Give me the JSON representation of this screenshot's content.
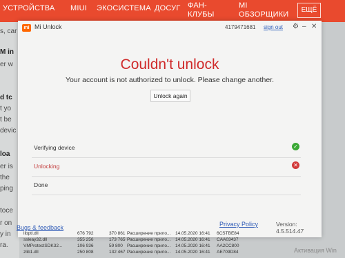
{
  "browser_nav": {
    "items": [
      "УСТРОЙСТВА",
      "MIUI",
      "ЭКОСИСТЕМА",
      "ДОСУГ",
      "ФАН-\nКЛУБЫ",
      "MI\nОБЗОРЩИКИ"
    ],
    "more": "ЕЩЁ"
  },
  "background_text": [
    "s, car",
    "M in",
    "er w",
    "d tc",
    "t yo",
    "t be",
    "devic",
    "loa",
    "er is",
    "the",
    "ping",
    "toce",
    "r on",
    "y in",
    "ra."
  ],
  "window": {
    "title": "Mi Unlock",
    "account_id": "4179471681",
    "sign_out": "sign out",
    "heading": "Couldn't unlock",
    "message": "Your account is not authorized to unlock. Please change another.",
    "unlock_again": "Unlock again",
    "steps": [
      {
        "label": "Verifying device",
        "status": "ok"
      },
      {
        "label": "Unlocking",
        "status": "error"
      },
      {
        "label": "Done",
        "status": "none"
      }
    ],
    "privacy_policy": "Privacy Policy",
    "version": "Version: 4.5.514.47"
  },
  "bugs_feedback": "Bugs & feedback",
  "files": [
    {
      "name": "libptl.dll",
      "size": "676 792",
      "packed": "370 861",
      "type": "Расширение прило...",
      "date": "14.05.2020 16:41",
      "crc": "6CSTBE84"
    },
    {
      "name": "ssleay32.dll",
      "size": "355 256",
      "packed": "173 765",
      "type": "Расширение прило...",
      "date": "14.05.2020 16:41",
      "crc": "CAA03437"
    },
    {
      "name": "VMProtectSDK32...",
      "size": "106 936",
      "packed": "59 800",
      "type": "Расширение прило...",
      "date": "14.05.2020 16:41",
      "crc": "AA2CC800"
    },
    {
      "name": "zlib1.dll",
      "size": "250 808",
      "packed": "132 467",
      "type": "Расширение прило...",
      "date": "14.05.2020 16:41",
      "crc": "AE709D84"
    }
  ],
  "watermark": "Активация Win"
}
